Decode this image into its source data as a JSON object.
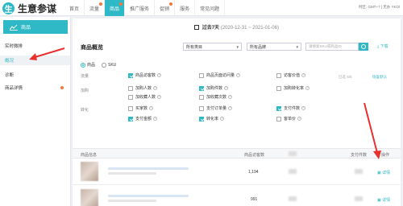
{
  "app": {
    "logo_char": "生",
    "name": "生意参谋"
  },
  "nav": [
    {
      "label": "首页",
      "active": false,
      "dot": false
    },
    {
      "label": "流量",
      "active": false,
      "dot": true
    },
    {
      "label": "商品",
      "active": true,
      "dot": true
    },
    {
      "label": "推广服务",
      "active": false,
      "dot": false
    },
    {
      "label": "促销",
      "active": false,
      "dot": true
    },
    {
      "label": "服务",
      "active": false,
      "dot": false
    },
    {
      "label": "常见问题",
      "active": false,
      "dot": false
    }
  ],
  "timezone": "时区: GMT+7 | 无办 YKOl",
  "sidebar": {
    "header": "商品",
    "items": [
      {
        "label": "实时微排",
        "active": false
      },
      {
        "label": "概况",
        "active": true
      },
      {
        "label": "诊断",
        "active": false
      },
      {
        "label": "商品详情",
        "active": false,
        "dot": true
      }
    ]
  },
  "date_range": {
    "prefix": "过去7天",
    "range": "(2020-12-31 ~ 2021-01-06)"
  },
  "overview": {
    "title": "商品概览",
    "category_select": "所有类目",
    "brand_select": "所有品牌",
    "search_placeholder": "请搜索SKU或商品ID",
    "download": "下载",
    "radios": [
      "商品",
      "SKU"
    ],
    "groups": [
      "流量",
      "加购",
      "转化"
    ],
    "checkboxes": [
      {
        "label": "商品访客数",
        "checked": true
      },
      {
        "label": "商品页面访问量",
        "checked": false
      },
      {
        "label": "访客价值",
        "checked": false
      },
      {
        "label": "加购人数",
        "checked": false
      },
      {
        "label": "加购件数",
        "checked": true
      },
      {
        "label": "加购转化率",
        "checked": false
      },
      {
        "label": "加收藏人数",
        "checked": false
      },
      {
        "label": "加收藏次数",
        "checked": false
      },
      {
        "label": "买家数",
        "checked": false
      },
      {
        "label": "支付订单量",
        "checked": false
      },
      {
        "label": "支付件数",
        "checked": true
      },
      {
        "label": "支付金额",
        "checked": true
      },
      {
        "label": "转化率",
        "checked": true
      },
      {
        "label": "客单价",
        "checked": false
      }
    ],
    "selected_counter": "已选 5/5",
    "restore": "恢复默认"
  },
  "table": {
    "headers": [
      "商品信息",
      "商品访客数",
      "支付件数",
      "操作"
    ],
    "rows": [
      {
        "visitors": "1,194",
        "action": "详情"
      },
      {
        "visitors": "991",
        "action": "详情"
      }
    ]
  }
}
